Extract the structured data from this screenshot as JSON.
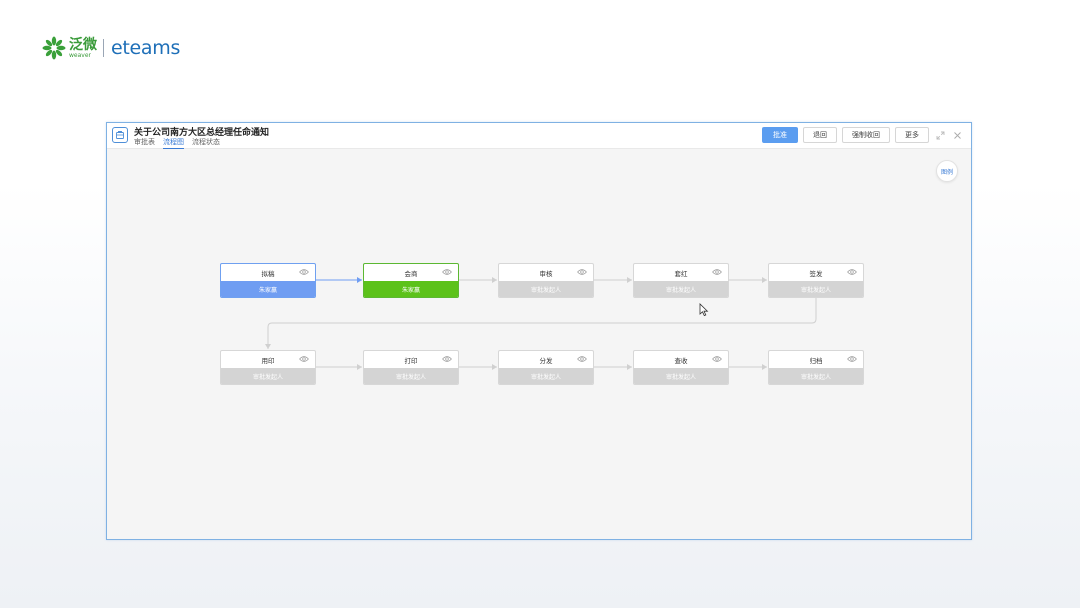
{
  "brand": {
    "cn_name": "泛微",
    "en_name": "weaver",
    "product": "eteams",
    "color_green": "#3a9b3a",
    "color_blue": "#1e6fb8"
  },
  "window": {
    "title": "关于公司南方大区总经理任命通知",
    "tabs": [
      {
        "label": "审批表",
        "active": false
      },
      {
        "label": "流程图",
        "active": true
      },
      {
        "label": "流程状态",
        "active": false
      }
    ],
    "actions": {
      "approve": "批准",
      "return": "退回",
      "force_recall": "强制收回",
      "more": "更多"
    },
    "legend_label": "图例"
  },
  "flow": {
    "colors": {
      "done": "#6f9df2",
      "current": "#5cc21a",
      "pending": "#d4d4d4"
    },
    "nodes": [
      {
        "id": "n1",
        "name": "拟稿",
        "assignee": "朱家赢",
        "status": "done",
        "icon": "eye-icon"
      },
      {
        "id": "n2",
        "name": "会商",
        "assignee": "朱家赢",
        "status": "current",
        "icon": "eye-icon"
      },
      {
        "id": "n3",
        "name": "审核",
        "assignee": "审批发起人",
        "status": "pending",
        "icon": "eye-icon"
      },
      {
        "id": "n4",
        "name": "套红",
        "assignee": "审批发起人",
        "status": "pending",
        "icon": "eye-icon"
      },
      {
        "id": "n5",
        "name": "签发",
        "assignee": "审批发起人",
        "status": "pending",
        "icon": "eye-icon"
      },
      {
        "id": "n6",
        "name": "用印",
        "assignee": "审批发起人",
        "status": "pending",
        "icon": "eye-icon"
      },
      {
        "id": "n7",
        "name": "打印",
        "assignee": "审批发起人",
        "status": "pending",
        "icon": "eye-icon"
      },
      {
        "id": "n8",
        "name": "分发",
        "assignee": "审批发起人",
        "status": "pending",
        "icon": "eye-icon"
      },
      {
        "id": "n9",
        "name": "查收",
        "assignee": "审批发起人",
        "status": "pending",
        "icon": "eye-icon"
      },
      {
        "id": "n10",
        "name": "归档",
        "assignee": "审批发起人",
        "status": "pending",
        "icon": "eye-icon"
      }
    ]
  }
}
